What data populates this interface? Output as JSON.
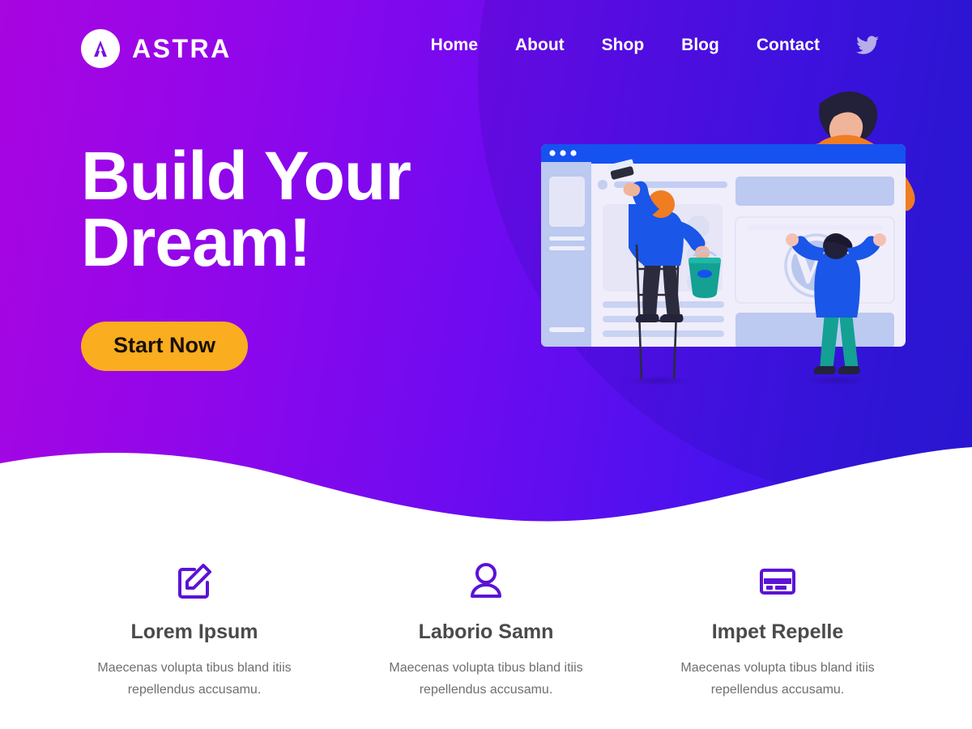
{
  "brand": {
    "name": "ASTRA",
    "mark_icon": "astra-a-logo-icon",
    "mark_color": "#7a0fe0",
    "text_color": "#ffffff"
  },
  "nav": {
    "items": [
      {
        "label": "Home",
        "name": "nav-item-home"
      },
      {
        "label": "About",
        "name": "nav-item-about"
      },
      {
        "label": "Shop",
        "name": "nav-item-shop"
      },
      {
        "label": "Blog",
        "name": "nav-item-blog"
      },
      {
        "label": "Contact",
        "name": "nav-item-contact"
      }
    ],
    "social": {
      "icon": "twitter-bird-icon",
      "color": "#b6aeea"
    }
  },
  "hero": {
    "headline_line1": "Build Your",
    "headline_line2": "Dream!",
    "cta_label": "Start Now",
    "cta_bg": "#f9ad1f",
    "cta_text_color": "#1a1008",
    "gradient_from": "#a805e0",
    "gradient_to": "#2d19dd",
    "illustration": {
      "name": "website-building-illustration",
      "browser_titlebar_color": "#1552f0",
      "browser_body_color": "#f0eefb",
      "sidebar_color": "#bcc9f0",
      "accent_blue": "#1a56e8",
      "accent_orange": "#f07d22",
      "accent_teal": "#14a093",
      "wordpress_logo": "wordpress-logo-icon",
      "characters": [
        "woman-leaning-over-browser",
        "painter-on-ladder",
        "person-placing-wordpress-logo"
      ]
    }
  },
  "features": {
    "icon_color": "#5b13d6",
    "items": [
      {
        "icon": "pencil-edit-square-icon",
        "title": "Lorem Ipsum",
        "text": "Maecenas volupta tibus bland itiis repellendus accusamu."
      },
      {
        "icon": "user-person-icon",
        "title": "Laborio Samn",
        "text": "Maecenas volupta tibus bland itiis repellendus accusamu."
      },
      {
        "icon": "credit-card-icon",
        "title": "Impet Repelle",
        "text": "Maecenas volupta tibus bland itiis repellendus accusamu."
      }
    ]
  }
}
